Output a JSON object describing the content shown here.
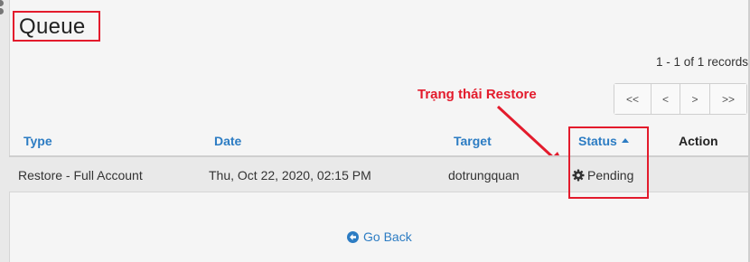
{
  "page": {
    "title": "Queue"
  },
  "pagination": {
    "records_text": "1 - 1 of 1 records",
    "first_label": "<<",
    "prev_label": "<",
    "next_label": ">",
    "last_label": ">>"
  },
  "annotation": {
    "label": "Trạng thái Restore",
    "color": "#e31b2c"
  },
  "table": {
    "columns": {
      "type": "Type",
      "date": "Date",
      "target": "Target",
      "status": "Status",
      "action": "Action"
    },
    "rows": [
      {
        "type": "Restore - Full Account",
        "date": "Thu, Oct 22, 2020, 02:15 PM",
        "target": "dotrungquan",
        "status": "Pending",
        "status_icon": "gear-icon"
      }
    ],
    "sort": {
      "column": "Status",
      "direction": "ascending"
    }
  },
  "footer": {
    "go_back_label": "Go Back",
    "go_back_icon": "arrow-left-circle-icon"
  },
  "colors": {
    "link": "#2c7cc3",
    "highlight": "#e31b2c",
    "background": "#f5f5f5",
    "row": "#e9e9e9"
  }
}
